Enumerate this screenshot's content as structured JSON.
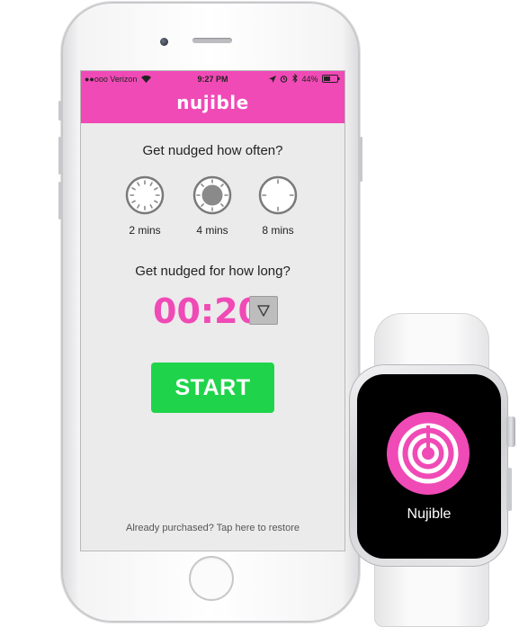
{
  "status_bar": {
    "carrier": "●●ooo Verizon",
    "time": "9:27 PM",
    "battery": "44%"
  },
  "app": {
    "title": "nujible",
    "question_frequency": "Get nudged how often?",
    "frequency_options": [
      {
        "label": "2 mins",
        "selected": false
      },
      {
        "label": "4 mins",
        "selected": true
      },
      {
        "label": "8 mins",
        "selected": false
      }
    ],
    "question_duration": "Get nudged for how long?",
    "duration_value": "00:20",
    "start_label": "START",
    "restore_text": "Already purchased? Tap here to restore"
  },
  "watch": {
    "app_name": "Nujible"
  },
  "colors": {
    "brand_pink": "#f04ab6",
    "start_green": "#1fd44a",
    "screen_bg": "#ebebeb"
  },
  "icons": {
    "wifi": "wifi-icon",
    "location": "location-arrow-icon",
    "alarm": "alarm-icon",
    "bluetooth": "bluetooth-icon",
    "battery": "battery-icon",
    "dropdown": "triangle-down-icon",
    "watch_app": "concentric-rings-icon"
  }
}
